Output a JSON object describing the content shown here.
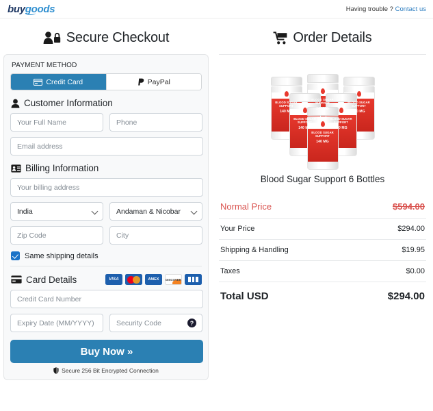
{
  "header": {
    "logo_buy": "buy",
    "logo_goods": "goods",
    "help_text": "Having trouble ?",
    "contact_link": "Contact us"
  },
  "checkout": {
    "title": "Secure Checkout",
    "payment_method_label": "PAYMENT METHOD",
    "tabs": [
      {
        "label": "Credit Card",
        "icon": "credit-card-icon",
        "active": true
      },
      {
        "label": "PayPal",
        "icon": "paypal-icon",
        "active": false
      }
    ],
    "customer_section": {
      "heading": "Customer Information",
      "full_name_placeholder": "Your Full Name",
      "phone_placeholder": "Phone",
      "email_placeholder": "Email address"
    },
    "billing_section": {
      "heading": "Billing Information",
      "address_placeholder": "Your billing address",
      "country_value": "India",
      "state_value": "Andaman & Nicobar",
      "zip_placeholder": "Zip Code",
      "city_placeholder": "City"
    },
    "same_shipping_label": "Same shipping details",
    "same_shipping_checked": true,
    "card_section": {
      "heading": "Card Details",
      "brands": [
        "VISA",
        "Mastercard",
        "AMEX",
        "DISCOVER",
        "JCB"
      ],
      "brand_visa_text": "VISA",
      "brand_amex_text": "AMEX",
      "brand_discover_text": "DISCOVER",
      "card_number_placeholder": "Credit Card Number",
      "expiry_placeholder": "Expiry Date (MM/YYYY)",
      "security_placeholder": "Security Code",
      "security_help_glyph": "?"
    },
    "buy_button_label": "Buy Now »",
    "secure_note": "Secure 256 Bit Encrypted Connection"
  },
  "order": {
    "title": "Order Details",
    "product_name": "Blood Sugar Support 6 Bottles",
    "bottle_label_line1": "BLOOD SUGAR",
    "bottle_label_line2": "SUPPORT",
    "bottle_label_mg": "140 MG",
    "lines": [
      {
        "label": "Normal Price",
        "value": "$594.00",
        "style": "normal"
      },
      {
        "label": "Your Price",
        "value": "$294.00",
        "style": "plain"
      },
      {
        "label": "Shipping & Handling",
        "value": "$19.95",
        "style": "plain"
      },
      {
        "label": "Taxes",
        "value": "$0.00",
        "style": "plain"
      },
      {
        "label": "Total USD",
        "value": "$294.00",
        "style": "total"
      }
    ]
  },
  "colors": {
    "accent_blue": "#2b80b3",
    "link_blue": "#2f7fc1",
    "price_red": "#d9534f",
    "panel_bg": "#f8f9fa"
  }
}
